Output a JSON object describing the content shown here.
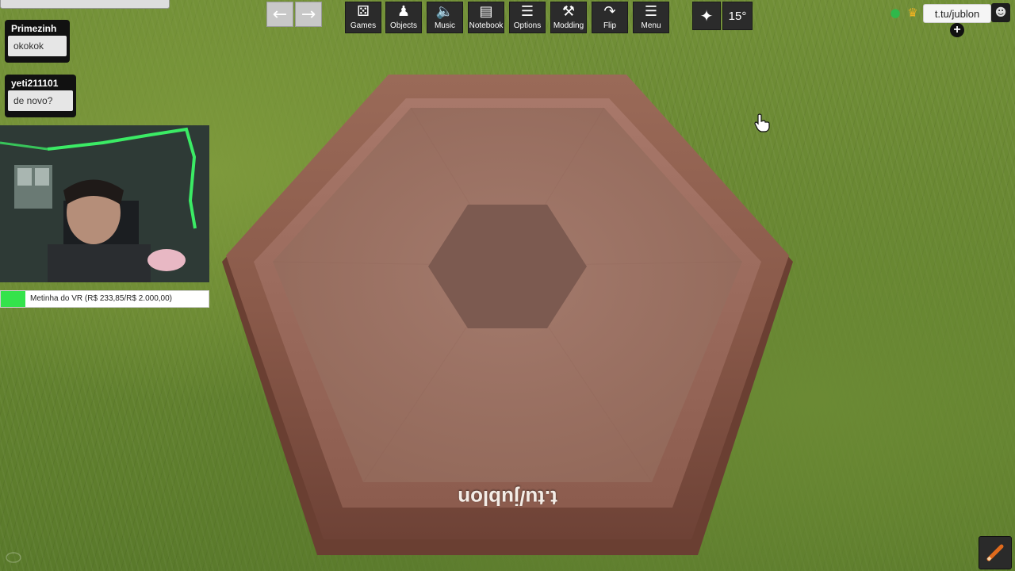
{
  "toolbar": {
    "undo_icon": "arrow-left-icon",
    "redo_icon": "arrow-right-icon",
    "buttons": [
      {
        "label": "Games",
        "icon": "games-icon"
      },
      {
        "label": "Objects",
        "icon": "objects-icon"
      },
      {
        "label": "Music",
        "icon": "music-icon"
      },
      {
        "label": "Notebook",
        "icon": "notebook-icon"
      },
      {
        "label": "Options",
        "icon": "options-icon"
      },
      {
        "label": "Modding",
        "icon": "modding-icon"
      },
      {
        "label": "Flip",
        "icon": "flip-icon"
      },
      {
        "label": "Menu",
        "icon": "menu-icon"
      }
    ],
    "figure_icon": "figure-icon",
    "rotation_angle": "15°"
  },
  "players": {
    "host_icon": "player-green-icon",
    "crown_icon": "crown-icon",
    "name": "t.tu/jublon",
    "avatar_icon": "avatar-icon",
    "add_icon": "add-player-icon"
  },
  "chat": {
    "messages": [
      {
        "user": "Primezinh",
        "text": "okokok"
      },
      {
        "user": "yeti211101",
        "text": "de novo?"
      }
    ]
  },
  "goal": {
    "text": "Metinha do VR (R$ 233,85/R$ 2.000,00)",
    "progress": 0.117
  },
  "table": {
    "label": "t.tu/jublon"
  },
  "colors": {
    "grass": "#668531",
    "wood": "#8e5d4e",
    "toolbar": "#2b2b2b",
    "goal_fill": "#34e34b"
  }
}
